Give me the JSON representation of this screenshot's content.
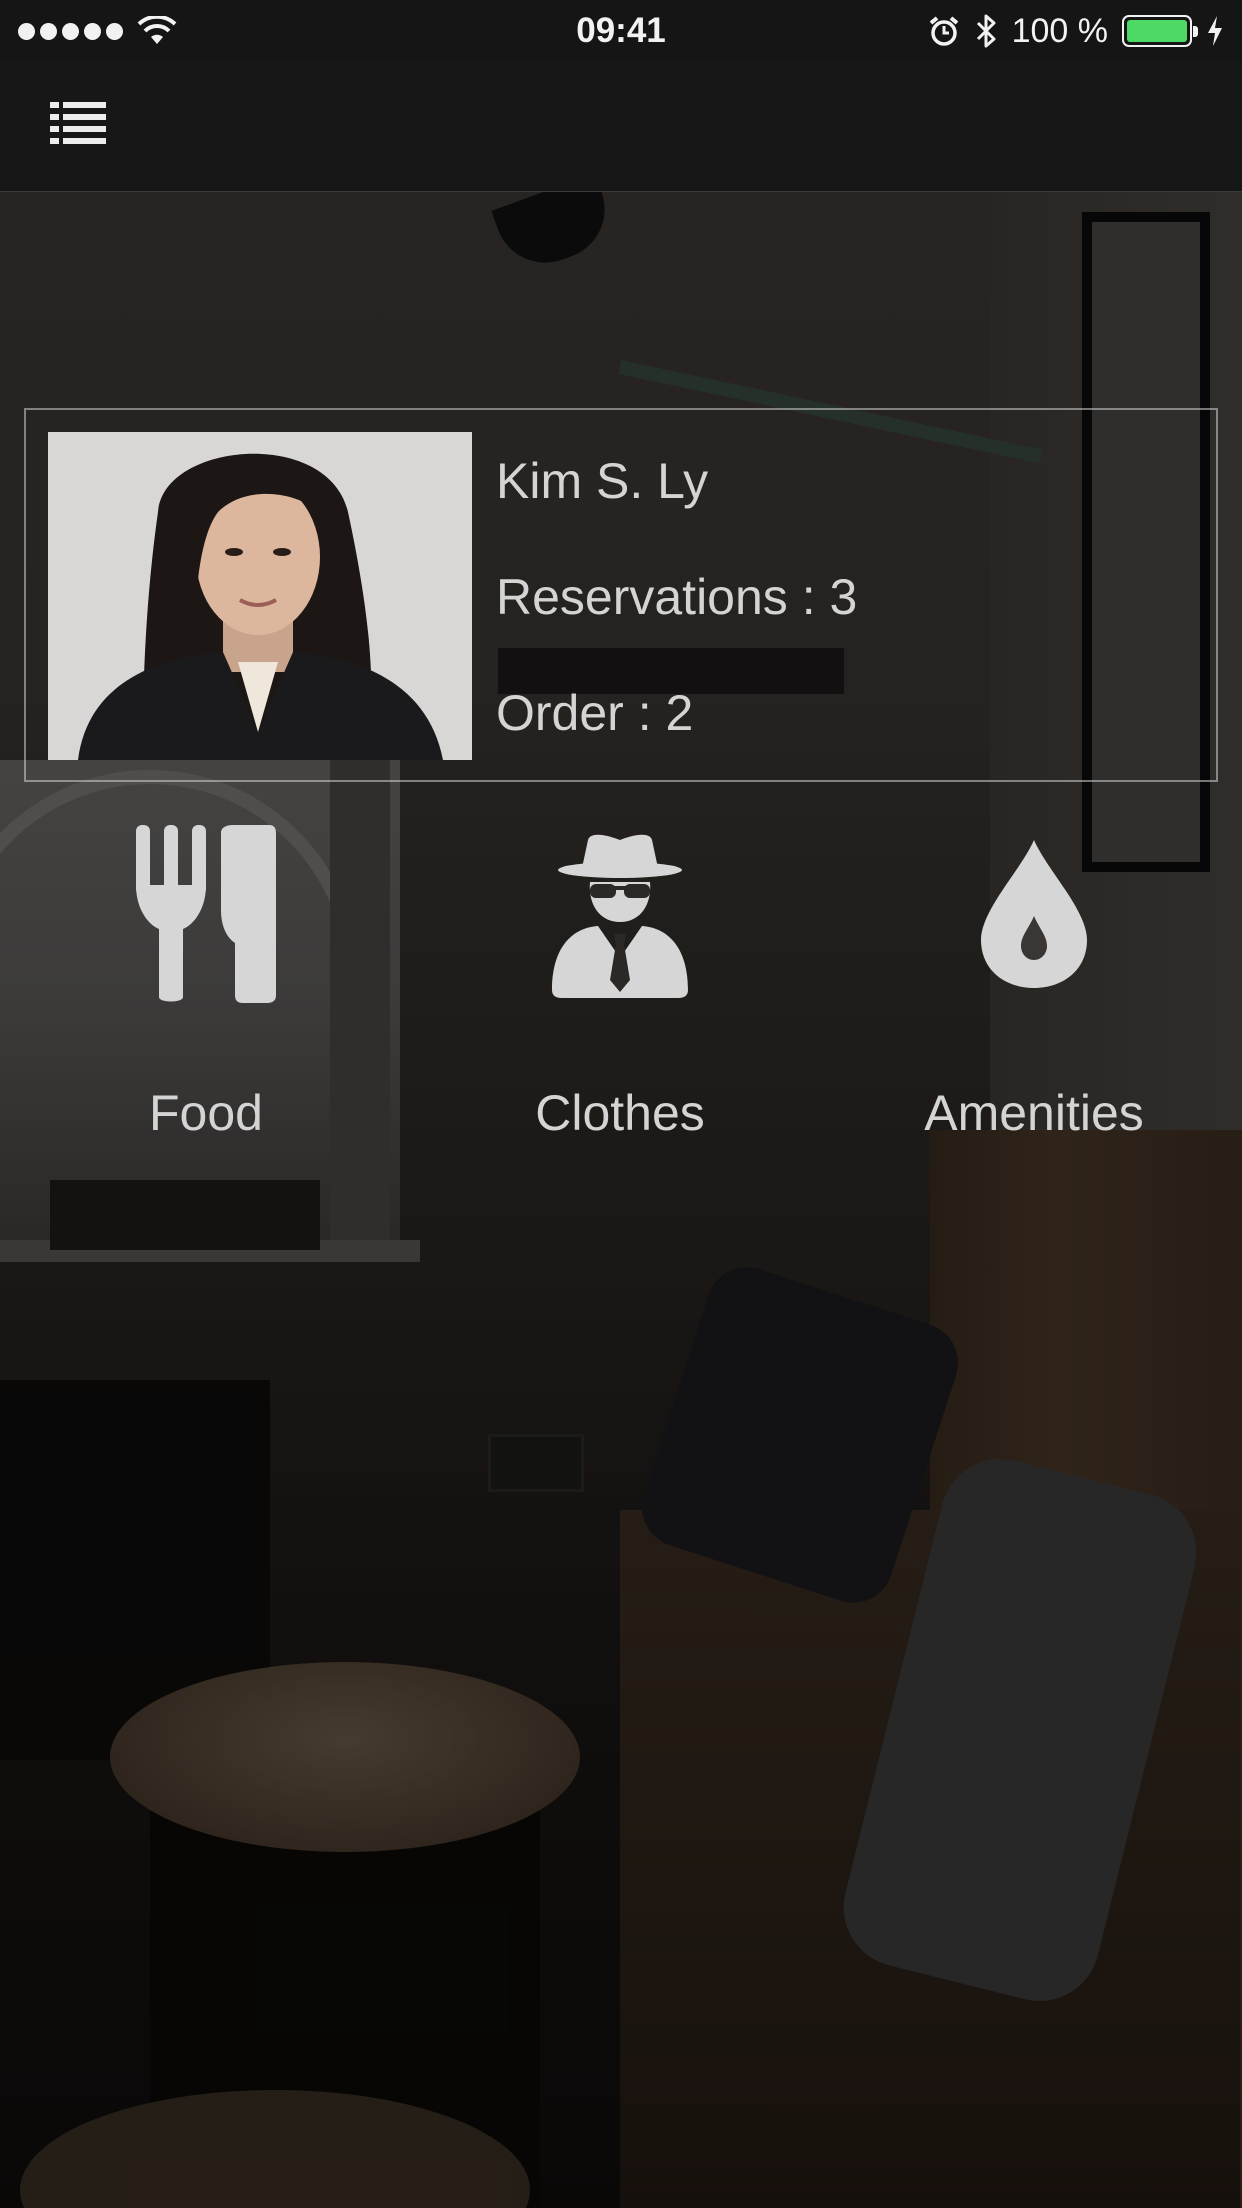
{
  "status_bar": {
    "time": "09:41",
    "battery_percent": "100 %",
    "battery_level": 1.0,
    "signal_bars": 5,
    "battery_color": "#4cd964",
    "icons": [
      "wifi-icon",
      "alarm-icon",
      "bluetooth-icon",
      "charging-icon"
    ]
  },
  "nav": {
    "menu_icon": "list-menu-icon"
  },
  "profile": {
    "name": "Kim S. Ly",
    "reservations": "Reservations : 3",
    "order": "Order : 2"
  },
  "categories": [
    {
      "label": "Food",
      "icon": "fork-knife-icon"
    },
    {
      "label": "Clothes",
      "icon": "incognito-icon"
    },
    {
      "label": "Amenities",
      "icon": "water-drop-icon"
    }
  ],
  "colors": {
    "bar_background": "#151515",
    "text": "#d4d4d4",
    "icon": "#d6d6d6"
  }
}
